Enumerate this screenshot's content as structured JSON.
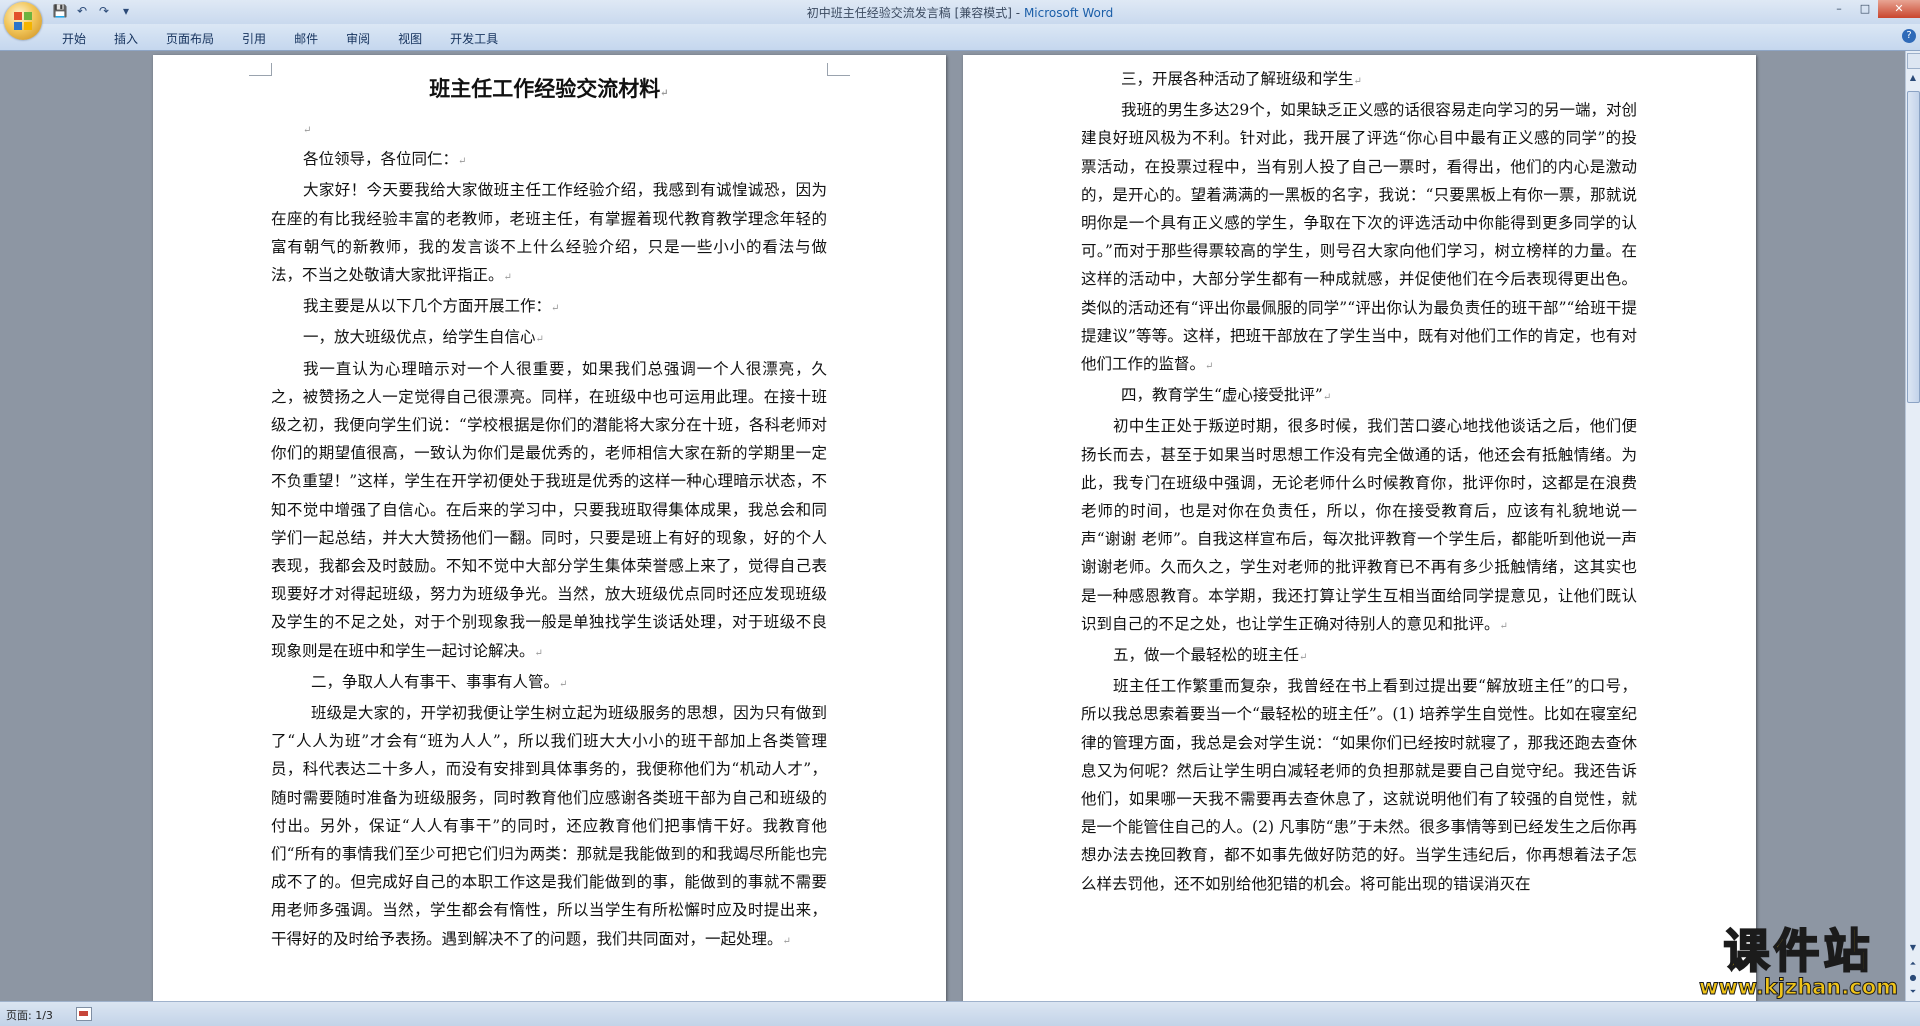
{
  "window": {
    "doc_name": "初中班主任经验交流发言稿 [兼容模式]",
    "separator": " - ",
    "app_name": "Microsoft Word",
    "min_label": "–",
    "max_label": "□",
    "close_label": "✕"
  },
  "qat": {
    "save": "💾",
    "undo": "↶",
    "redo": "↷",
    "more": "▾"
  },
  "ribbon": {
    "tabs": [
      "开始",
      "插入",
      "页面布局",
      "引用",
      "邮件",
      "审阅",
      "视图",
      "开发工具"
    ],
    "help": "?"
  },
  "document": {
    "page1": {
      "title": "班主任工作经验交流材料",
      "blank": "",
      "paragraphs": [
        "各位领导，各位同仁：",
        "大家好！今天要我给大家做班主任工作经验介绍，我感到有诚惶诚恐，因为在座的有比我经验丰富的老教师，老班主任，有掌握着现代教育教学理念年轻的富有朝气的新教师，我的发言谈不上什么经验介绍，只是一些小小的看法与做法，不当之处敬请大家批评指正。",
        "我主要是从以下几个方面开展工作：",
        "一，放大班级优点，给学生自信心",
        "我一直认为心理暗示对一个人很重要，如果我们总强调一个人很漂亮，久之，被赞扬之人一定觉得自己很漂亮。同样，在班级中也可运用此理。在接十班级之初，我便向学生们说：“学校根据是你们的潜能将大家分在十班，各科老师对你们的期望值很高，一致认为你们是最优秀的，老师相信大家在新的学期里一定不负重望！”这样，学生在开学初便处于我班是优秀的这样一种心理暗示状态，不知不觉中增强了自信心。在后来的学习中，只要我班取得集体成果，我总会和同学们一起总结，并大大赞扬他们一翻。同时，只要是班上有好的现象，好的个人表现，我都会及时鼓励。不知不觉中大部分学生集体荣誉感上来了，觉得自己表现要好才对得起班级，努力为班级争光。当然，放大班级优点同时还应发现班级及学生的不足之处，对于个别现象我一般是单独找学生谈话处理，对于班级不良现象则是在班中和学生一起讨论解决。",
        "二，争取人人有事干、事事有人管。",
        "班级是大家的，开学初我便让学生树立起为班级服务的思想，因为只有做到了“人人为班”才会有“班为人人”，所以我们班大大小小的班干部加上各类管理员，科代表达二十多人，而没有安排到具体事务的，我便称他们为“机动人才”，随时需要随时准备为班级服务，同时教育他们应感谢各类班干部为自己和班级的付出。另外，保证“人人有事干”的同时，还应教育他们把事情干好。我教育他们“所有的事情我们至少可把它们归为两类：那就是我能做到的和我竭尽所能也完成不了的。但完成好自己的本职工作这是我们能做到的事，能做到的事就不需要用老师多强调。当然，学生都会有惰性，所以当学生有所松懈时应及时提出来，干得好的及时给予表扬。遇到解决不了的问题，我们共同面对，一起处理。"
      ]
    },
    "page2": {
      "paragraphs": [
        "三，开展各种活动了解班级和学生",
        "我班的男生多达29个，如果缺乏正义感的话很容易走向学习的另一端，对创建良好班风极为不利。针对此，我开展了评选“你心目中最有正义感的同学”的投票活动，在投票过程中，当有别人投了自己一票时，看得出，他们的内心是激动的，是开心的。望着满满的一黑板的名字，我说：“只要黑板上有你一票，那就说明你是一个具有正义感的学生，争取在下次的评选活动中你能得到更多同学的认可。”而对于那些得票较高的学生，则号召大家向他们学习，树立榜样的力量。在这样的活动中，大部分学生都有一种成就感，并促使他们在今后表现得更出色。类似的活动还有“评出你最佩服的同学”“评出你认为最负责任的班干部”“给班干提提建议”等等。这样，把班干部放在了学生当中，既有对他们工作的肯定，也有对他们工作的监督。",
        "四，教育学生“虚心接受批评”",
        "初中生正处于叛逆时期，很多时候，我们苦口婆心地找他谈话之后，他们便扬长而去，甚至于如果当时思想工作没有完全做通的话，他还会有抵触情绪。为此，我专门在班级中强调，无论老师什么时候教育你，批评你时，这都是在浪费老师的时间，也是对你在负责任，所以，你在接受教育后，应该有礼貌地说一声“谢谢 老师”。自我这样宣布后，每次批评教育一个学生后，都能听到他说一声谢谢老师。久而久之，学生对老师的批评教育已不再有多少抵触情绪，这其实也是一种感恩教育。本学期，我还打算让学生互相当面给同学提意见，让他们既认识到自己的不足之处，也让学生正确对待别人的意见和批评。",
        "五，做一个最轻松的班主任",
        "班主任工作繁重而复杂，我曾经在书上看到过提出要“解放班主任”的口号，所以我总思索着要当一个“最轻松的班主任”。(1) 培养学生自觉性。比如在寝室纪律的管理方面，我总是会对学生说：“如果你们已经按时就寝了，那我还跑去查休息又为何呢？然后让学生明白减轻老师的负担那就是要自己自觉守纪。我还告诉他们，如果哪一天我不需要再去查休息了，这就说明他们有了较强的自觉性，就是一个能管住自己的人。(2) 凡事防“患”于未然。很多事情等到已经发生之后你再想办法去挽回教育，都不如事先做好防范的好。当学生违纪后，你再想着法子怎么样去罚他，还不如别给他犯错的机会。将可能出现的错误消灭在"
      ]
    },
    "para_mark": "↵"
  },
  "statusbar": {
    "page_info": "页面: 1/3"
  },
  "watermark": {
    "main": "课件站",
    "url": "www.kjzhan.com"
  },
  "colors": {
    "app_title": "#1b5ea8",
    "watermark": "#f0c419",
    "workspace": "#8d96a3"
  }
}
